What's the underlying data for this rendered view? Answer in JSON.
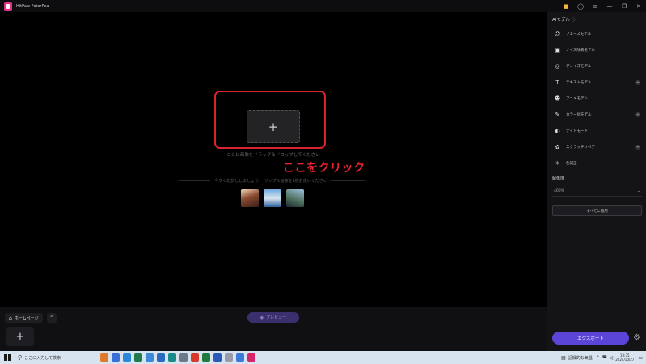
{
  "window": {
    "title": "HitPaw FotorPea",
    "controls": [
      "gift-icon",
      "account-icon",
      "menu-icon",
      "minimize-icon",
      "maximize-icon",
      "close-icon"
    ]
  },
  "canvas": {
    "upload_plus": "+",
    "drop_text": "ここに画像をドラッグ＆ドロップしてください",
    "sample_text": "今すぐお試ししましょう！ サンプル画像を1枚お使いください",
    "annotation": "ここをクリック",
    "annotation_color": "#e8232f",
    "highlight_color": "#d8242e"
  },
  "bottombar": {
    "home_label": "ホームページ",
    "collapse_glyph": "^",
    "preview_label": "プレビュー",
    "add_glyph": "+"
  },
  "panel": {
    "title": "AIモデル",
    "models": [
      {
        "label": "フェースモデル",
        "icon": "face-icon",
        "glyph": "☺",
        "addable": false
      },
      {
        "label": "ノイズ除去モデル",
        "icon": "denoise-icon",
        "glyph": "▣",
        "addable": false
      },
      {
        "label": "デノイズモデル",
        "icon": "lens-icon",
        "glyph": "◎",
        "addable": false
      },
      {
        "label": "テキストモデル",
        "icon": "text-icon",
        "glyph": "T",
        "addable": true
      },
      {
        "label": "アニメモデル",
        "icon": "anime-icon",
        "glyph": "☻",
        "addable": false
      },
      {
        "label": "カラー化モデル",
        "icon": "colorize-icon",
        "glyph": "✎",
        "addable": true
      },
      {
        "label": "ナイトモード",
        "icon": "night-icon",
        "glyph": "◐",
        "addable": false
      },
      {
        "label": "スクラッチリペア",
        "icon": "scratch-icon",
        "glyph": "✿",
        "addable": true
      },
      {
        "label": "色補正",
        "icon": "color-correct-icon",
        "glyph": "☀",
        "addable": false
      }
    ],
    "resolution_label": "解像度",
    "resolution_value": "400%",
    "apply_all_label": "すべてに適用",
    "export_label": "エクスポート",
    "accent_color": "#5b45d8"
  },
  "taskbar": {
    "search_placeholder": "ここに入力して検索",
    "apps": [
      "#e07a2a",
      "#3b6fd8",
      "#2b88d8",
      "#1f7a4c",
      "#3a8ad8",
      "#2a6ac0",
      "#1a8a8a",
      "#6a7a8a",
      "#d83a2a",
      "#1f7a3c",
      "#2a5ab8",
      "#9a9aaa",
      "#3a7ad8",
      "#d8246a"
    ],
    "weather": "記録的な気温",
    "time": "10:35",
    "date": "2024/10/27"
  }
}
